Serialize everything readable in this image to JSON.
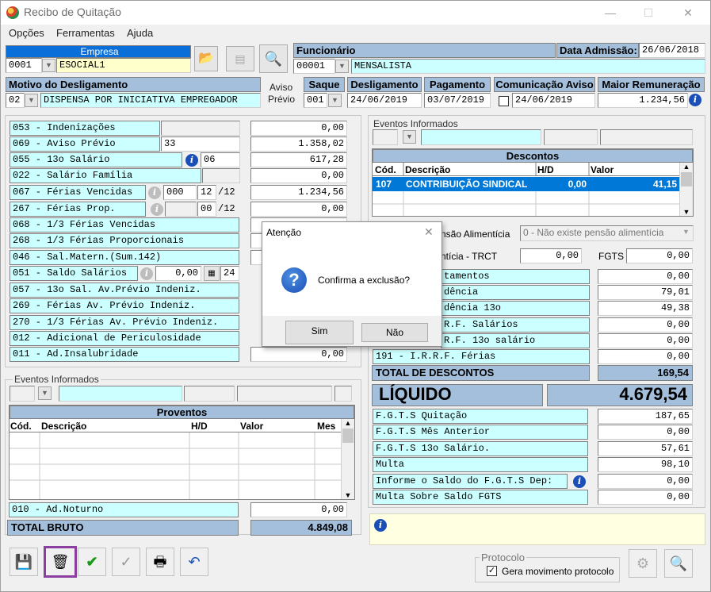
{
  "window": {
    "title": "Recibo de Quitação"
  },
  "menu": {
    "opcoes": "Opções",
    "ferramentas": "Ferramentas",
    "ajuda": "Ajuda"
  },
  "empresa": {
    "header": "Empresa",
    "code": "0001",
    "name": "ESOCIAL1"
  },
  "funcionario": {
    "header": "Funcionário",
    "code": "00001",
    "name": "MENSALISTA"
  },
  "admissao": {
    "label": "Data Admissão:",
    "value": "26/06/2018"
  },
  "motivo": {
    "header": "Motivo do Desligamento",
    "code": "02",
    "desc": "DISPENSA POR INICIATIVA EMPREGADOR"
  },
  "aviso_previo": {
    "line1": "Aviso",
    "line2": "Prévio"
  },
  "saque": {
    "header": "Saque",
    "code": "001"
  },
  "desligamento": {
    "header": "Desligamento",
    "value": "24/06/2019"
  },
  "pagamento": {
    "header": "Pagamento",
    "value": "03/07/2019"
  },
  "comunicacao": {
    "header": "Comunicação Aviso",
    "value": "24/06/2019"
  },
  "maior_remuneracao": {
    "header": "Maior Remuneração",
    "value": "1.234,56"
  },
  "left_items": [
    {
      "label": "053 - Indenizações",
      "value": "0,00"
    },
    {
      "label": "069 - Aviso Prévio",
      "extra": "33",
      "value": "1.358,02"
    },
    {
      "label": "055 - 13o Salário",
      "extra": "06",
      "value": "617,28"
    },
    {
      "label": "022 - Salário Família",
      "value": "0,00"
    },
    {
      "label": "067 - Férias Vencidas",
      "extra": "000",
      "extra2": "12",
      "extra3": "/12",
      "value": "1.234,56"
    },
    {
      "label": "267 - Férias Prop.",
      "extra2": "00",
      "extra3": "/12",
      "value": "0,00"
    },
    {
      "label": "068 - 1/3 Férias Vencidas"
    },
    {
      "label": "268 - 1/3 Férias Proporcionais"
    },
    {
      "label": "046 - Sal.Matern.(Sum.142)"
    },
    {
      "label": "051 - Saldo Salários",
      "extra": "0,00",
      "extra2": "24"
    },
    {
      "label": "057 - 13o Sal. Av.Prévio Indeniz."
    },
    {
      "label": "269 - Férias  Av. Prévio Indeniz."
    },
    {
      "label": "270 - 1/3 Férias Av. Prévio Indeniz."
    },
    {
      "label": "012 - Adicional de Periculosidade"
    },
    {
      "label": "011 - Ad.Insalubridade",
      "value": "0,00"
    }
  ],
  "eventos_left": {
    "title": "Eventos Informados"
  },
  "proventos": {
    "header": "Proventos",
    "cols": [
      "Cód.",
      "Descrição",
      "H/D",
      "Valor",
      "Mes"
    ]
  },
  "ad_noturno": {
    "label": "010 - Ad.Noturno",
    "value": "0,00"
  },
  "total_bruto": {
    "label": "TOTAL BRUTO",
    "value": "4.849,08"
  },
  "eventos_right": {
    "title": "Eventos Informados"
  },
  "descontos": {
    "header": "Descontos",
    "cols": [
      "Cód.",
      "Descrição",
      "H/D",
      "Valor"
    ],
    "rows": [
      {
        "cod": "107",
        "desc": "CONTRIBUIÇÃO SINDICAL",
        "hd": "0,00",
        "valor": "41,15"
      }
    ]
  },
  "pensao": {
    "label": "nsão Alimentícia",
    "value": "0 - Não existe pensão alimentícia"
  },
  "trct": {
    "label": "ntícia - TRCT",
    "value": "0,00"
  },
  "fgts": {
    "label": "FGTS",
    "value": "0,00"
  },
  "right_items": [
    {
      "label": "tamentos",
      "value": "0,00"
    },
    {
      "label": "dência",
      "value": "79,01"
    },
    {
      "label": "dência 13o",
      "value": "49,38"
    },
    {
      "label": "R.F. Salários",
      "value": "0,00"
    },
    {
      "label": "R.F. 13o salário",
      "value": "0,00"
    },
    {
      "label": "191 - I.R.R.F. Férias",
      "value": "0,00"
    }
  ],
  "total_descontos": {
    "label": "TOTAL DE DESCONTOS",
    "value": "169,54"
  },
  "liquido": {
    "label": "LÍQUIDO",
    "value": "4.679,54"
  },
  "fgts_items": [
    {
      "label": "F.G.T.S  Quitação",
      "value": "187,65"
    },
    {
      "label": "F.G.T.S  Mês Anterior",
      "value": "0,00"
    },
    {
      "label": "F.G.T.S  13o Salário.",
      "value": "57,61"
    },
    {
      "label": "Multa",
      "value": "98,10"
    },
    {
      "label": "Informe o Saldo do F.G.T.S Dep:",
      "value": "0,00"
    },
    {
      "label": "Multa Sobre Saldo FGTS",
      "value": "0,00"
    }
  ],
  "protocolo": {
    "title": "Protocolo",
    "checkbox_label": "Gera movimento protocolo"
  },
  "dialog": {
    "title": "Atenção",
    "message": "Confirma a exclusão?",
    "yes": "Sim",
    "no": "Não"
  },
  "colors": {
    "header_blue": "#a4bfdb",
    "field_cyan": "#ccffff",
    "selection": "#0078d7",
    "highlight": "#8a3ea0"
  }
}
